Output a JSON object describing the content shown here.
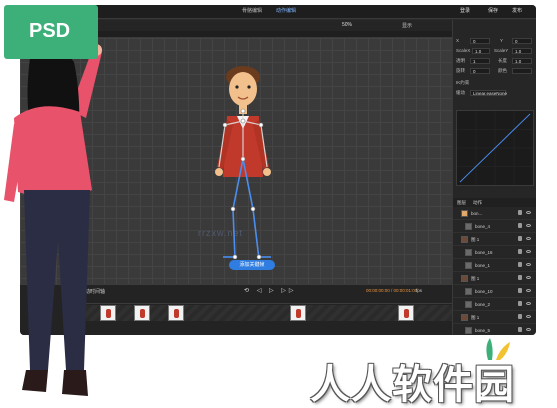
{
  "badge": {
    "label": "PSD"
  },
  "brand": {
    "text": "人人软件园"
  },
  "app": {
    "tabs": [
      "骨骼编辑",
      "动作编辑"
    ],
    "window_right": {
      "user": "登录",
      "save": "保存",
      "publish": "发布"
    },
    "toolbar": {
      "zoom": "50%",
      "tools": [
        "显示"
      ]
    },
    "canvas": {
      "add_keyframe_button": "添加关键帧",
      "watermark": "rrzxw.net"
    },
    "timeline": {
      "label": "运动时间轴",
      "controls": [
        "⟲",
        "◁",
        "▷",
        "▷▷"
      ],
      "time": "00:00:00:00 / 00:00:01:00",
      "fps": "fps"
    },
    "panel": {
      "properties": [
        {
          "label": "X",
          "value": "0",
          "label2": "Y",
          "value2": "0"
        },
        {
          "label": "ScaleX",
          "value": "1.0",
          "label2": "ScaleY",
          "value2": "1.0"
        },
        {
          "label": "透明",
          "value": "1",
          "label2": "长度",
          "value2": "1.0"
        },
        {
          "label": "旋转",
          "value": "0",
          "label2": "颜色",
          "value2": ""
        }
      ],
      "ik_label": "IK约束",
      "easing_label": "缓动",
      "easing_value": "Linear.easeNone",
      "layers_tabs": [
        "图层",
        "动作"
      ],
      "layers": [
        {
          "name": "bon..."
        },
        {
          "name": "bone_4"
        },
        {
          "name": "图 1"
        },
        {
          "name": "bone_16"
        },
        {
          "name": "bone_1"
        },
        {
          "name": "图 1"
        },
        {
          "name": "bone_10"
        },
        {
          "name": "bone_2"
        },
        {
          "name": "图 1"
        },
        {
          "name": "bone_5"
        },
        {
          "name": "bone_6"
        }
      ]
    }
  },
  "colors": {
    "badge": "#3db07a",
    "accent": "#2f7de1",
    "timecode": "#e8933a",
    "shirt": "#c0392b",
    "woman_top": "#e9526b"
  }
}
